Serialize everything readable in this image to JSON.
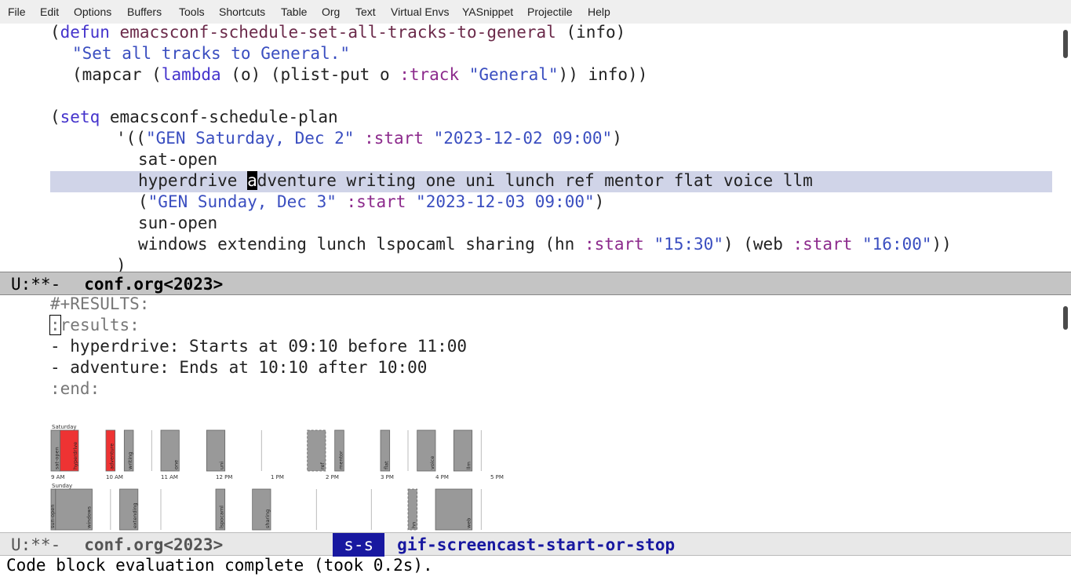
{
  "menubar": [
    "File",
    "Edit",
    "Options",
    "Buffers",
    "Tools",
    "Shortcuts",
    "Table",
    "Org",
    "Text",
    "Virtual Envs",
    "YASnippet",
    "Projectile",
    "Help"
  ],
  "code": {
    "l1": {
      "open": "(",
      "kw": "defun",
      "sp": " ",
      "fn": "emacsconf-schedule-set-all-tracks-to-general",
      "rest": " (info)"
    },
    "l2": {
      "str": "\"Set all tracks to General.\""
    },
    "l3": {
      "a": "(mapcar (",
      "kw": "lambda",
      "b": " (o) (plist-put o ",
      "key": ":track",
      "c": " ",
      "str": "\"General\"",
      "d": ")) info))"
    },
    "l4": {
      "open": "(",
      "kw": "setq",
      "rest": " emacsconf-schedule-plan"
    },
    "l5": {
      "a": "'((",
      "str": "\"GEN Saturday, Dec 2\"",
      "b": " ",
      "key": ":start",
      "c": " ",
      "str2": "\"2023-12-02 09:00\"",
      "d": ")"
    },
    "l6": "sat-open",
    "l7": {
      "pre": "hyperdrive ",
      "cursor": "a",
      "post": "dventure writing one uni lunch ref mentor flat voice llm"
    },
    "l8": {
      "a": "(",
      "str": "\"GEN Sunday, Dec 3\"",
      "b": " ",
      "key": ":start",
      "c": " ",
      "str2": "\"2023-12-03 09:00\"",
      "d": ")"
    },
    "l9": "sun-open",
    "l10": {
      "a": "windows extending lunch lspocaml sharing (hn ",
      "key": ":start",
      "b": " ",
      "str": "\"15:30\"",
      "c": ") (web ",
      "key2": ":start",
      "d": " ",
      "str2": "\"16:00\"",
      "e": "))"
    },
    "l11": ")"
  },
  "modeline_top": {
    "status": "U:**-",
    "buffer": "conf.org<2023>"
  },
  "results": {
    "header": "#+RESULTS:",
    "open_first": ":",
    "open_rest": "results:",
    "item1": "- hyperdrive: Starts at 09:10 before 11:00",
    "item2": "- adventure: Ends at 10:10 after 10:00",
    "end": ":end:"
  },
  "schedule": {
    "days": [
      {
        "label": "Saturday",
        "talks": [
          {
            "name": "sat-open",
            "start": "09:00",
            "end": "09:10",
            "state": "normal"
          },
          {
            "name": "hyperdrive",
            "start": "09:10",
            "end": "09:30",
            "state": "conflict"
          },
          {
            "name": "adventure",
            "start": "10:00",
            "end": "10:10",
            "state": "conflict"
          },
          {
            "name": "writing",
            "start": "10:20",
            "end": "10:30",
            "state": "normal"
          },
          {
            "name": "one",
            "start": "11:00",
            "end": "11:20",
            "state": "normal"
          },
          {
            "name": "uni",
            "start": "11:50",
            "end": "12:10",
            "state": "normal"
          },
          {
            "name": "ref",
            "start": "13:40",
            "end": "14:00",
            "state": "dashed"
          },
          {
            "name": "mentor",
            "start": "14:10",
            "end": "14:20",
            "state": "normal"
          },
          {
            "name": "flat",
            "start": "15:00",
            "end": "15:10",
            "state": "normal"
          },
          {
            "name": "voice",
            "start": "15:40",
            "end": "16:00",
            "state": "normal"
          },
          {
            "name": "llm",
            "start": "16:20",
            "end": "16:40",
            "state": "normal"
          }
        ],
        "markers": [
          "10:50",
          "12:50",
          "15:30",
          "16:50"
        ]
      },
      {
        "label": "Sunday",
        "talks": [
          {
            "name": "sun-open",
            "start": "09:00",
            "end": "09:05",
            "state": "normal"
          },
          {
            "name": "windows",
            "start": "09:05",
            "end": "09:45",
            "state": "normal"
          },
          {
            "name": "extending",
            "start": "10:15",
            "end": "10:35",
            "state": "normal"
          },
          {
            "name": "lspocaml",
            "start": "12:00",
            "end": "12:10",
            "state": "normal"
          },
          {
            "name": "sharing",
            "start": "12:40",
            "end": "13:00",
            "state": "normal"
          },
          {
            "name": "hn",
            "start": "15:30",
            "end": "15:40",
            "state": "dashed"
          },
          {
            "name": "web",
            "start": "16:00",
            "end": "16:40",
            "state": "normal"
          }
        ],
        "markers": [
          "10:05",
          "11:00",
          "13:50",
          "14:50",
          "16:50"
        ]
      }
    ],
    "ticks": [
      "9 AM",
      "10 AM",
      "11 AM",
      "12 PM",
      "1 PM",
      "2 PM",
      "3 PM",
      "4 PM",
      "5 PM"
    ]
  },
  "modeline_bottom": {
    "status": "U:**-",
    "buffer": "conf.org<2023>",
    "key": "s-s",
    "command": "gif-screencast-start-or-stop"
  },
  "echo": "Code block evaluation complete (took 0.2s).",
  "colors": {
    "conflict": "#ee3333",
    "normal": "#999999",
    "highlight": "#d0d4e8",
    "keyword": "#4433cc",
    "string": "#3a4ec0"
  }
}
